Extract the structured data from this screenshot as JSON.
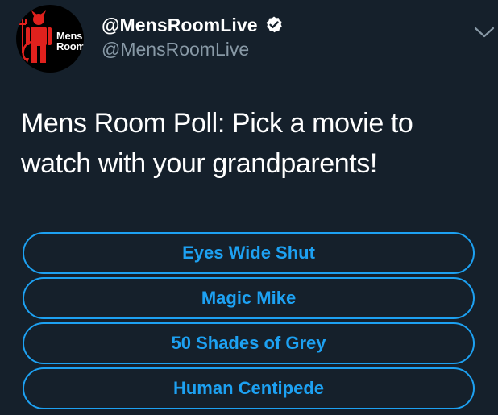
{
  "tweet": {
    "avatar": {
      "brand_line1": "Mens",
      "brand_line2": "Room"
    },
    "display_name": "@MensRoomLive",
    "handle": "@MensRoomLive",
    "verified_icon": "verified-badge-icon",
    "menu_icon": "chevron-down-icon",
    "text": "Mens Room Poll: Pick a movie to\nwatch with your grandparents!"
  },
  "poll": {
    "options": [
      {
        "label": "Eyes Wide Shut"
      },
      {
        "label": "Magic Mike"
      },
      {
        "label": "50 Shades of Grey"
      },
      {
        "label": "Human Centipede"
      }
    ]
  },
  "colors": {
    "background": "#15202b",
    "accent": "#1da1f2",
    "secondary_text": "#8899a6",
    "avatar_mascot": "#e0211d"
  }
}
